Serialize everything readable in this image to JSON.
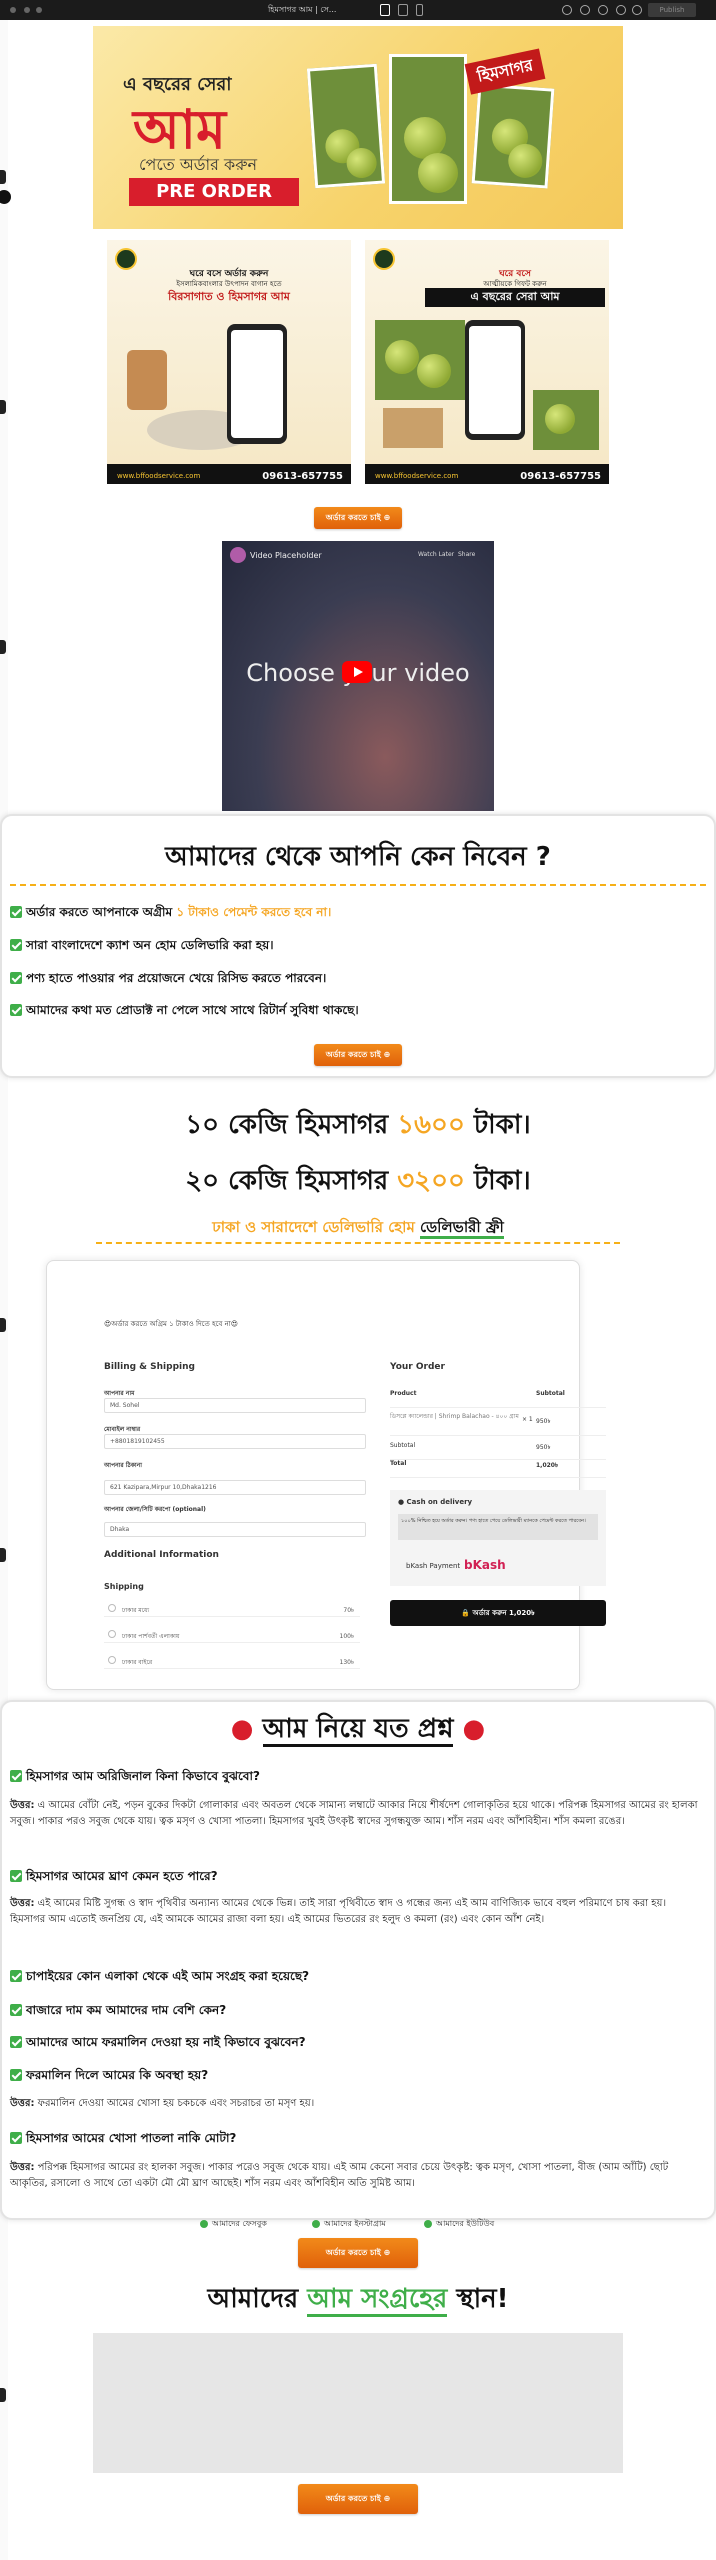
{
  "toolbar": {
    "title": "হিমসাগর আম | সে...",
    "publish": "Publish"
  },
  "hero": {
    "line1": "এ বছরের সেরা",
    "line2": "আম",
    "line3": "পেতে অর্ডার করুন",
    "cta": "PRE ORDER",
    "tag": "হিমসাগর"
  },
  "promo1": {
    "line1": "ঘরে বসে অর্ডার করুন",
    "line2": "ইসলামিকবাংলার উৎপাদন বাগান হতে",
    "line3": "বিরসাগাত ও হিমসাগর আম",
    "url": "www.bffoodservice.com",
    "phone": "09613-657755"
  },
  "promo2": {
    "line1": "ঘরে বসে",
    "line2": "আত্মীয়কে গিফট করুন",
    "line3": "এ বছরের সেরা আম",
    "url": "www.bffoodservice.com",
    "phone": "09613-657755"
  },
  "order_button": "অর্ডার করতে চাই ⊕",
  "video": {
    "title": "Video Placeholder",
    "watch_later": "Watch Later",
    "share": "Share",
    "choose": "Choose your video"
  },
  "why": {
    "title": "আমাদের থেকে আপনি কেন নিবেন ?",
    "items": [
      {
        "text": "অর্ডার করতে আপনাকে অগ্রীম ",
        "highlight": "১ টাকাও পেমেন্ট করতে হবে না।"
      },
      {
        "text": "সারা বাংলাদেশে ক্যাশ অন হোম ডেলিভারি করা হয়।",
        "highlight": ""
      },
      {
        "text": "পণ্য হাতে পাওয়ার পর প্রয়োজনে খেয়ে রিসিভ করতে পারবেন।",
        "highlight": ""
      },
      {
        "text": "আমাদের কথা মত প্রোডাক্ট না পেলে সাথে সাথে রিটার্ন সুবিধা থাকছে।",
        "highlight": ""
      }
    ]
  },
  "pricing": {
    "p1_pre": "১০ কেজি হিমসাগর ",
    "p1_price": "১৬০০",
    "p1_post": " টাকা।",
    "p2_pre": "২০ কেজি হিমসাগর ",
    "p2_price": "৩২০০",
    "p2_post": " টাকা।",
    "delivery_pre": "ঢাকা ও সারাদেশে ডেলিভারি হোম ",
    "delivery_free": "ডেলিভারী ফ্রী"
  },
  "checkout": {
    "notice": "😍অর্ডার করতে অগ্রিম ১ টাকাও দিতে হবে না😍",
    "billing_title": "Billing & Shipping",
    "name_label": "আপনার নাম",
    "name_value": "Md. Sohel",
    "phone_label": "মোবাইল নাম্বার",
    "phone_value": "+8801819102455",
    "address_label": "আপনার ঠিকানা",
    "address_value": "621 Kazipara,Mirpur 10,Dhaka1216",
    "city_label": "আপনার জেলা/সিটি করপো (optional)",
    "city_value": "Dhaka",
    "additional_title": "Additional Information",
    "shipping_title": "Shipping",
    "shipping": [
      {
        "label": "ঢাকার মধ্যে",
        "price": "70৳"
      },
      {
        "label": "ঢাকার পার্শবর্তী এলাকায়",
        "price": "100৳"
      },
      {
        "label": "ঢাকার বাইরে",
        "price": "130৳"
      }
    ],
    "order_title": "Your Order",
    "col_product": "Product",
    "col_subtotal": "Subtotal",
    "product": "ডিসপ্লে ক্যালেন্ডার | Shrimp Balachao - ৪০০ গ্রাম",
    "qty": "× 1",
    "product_price": "950৳",
    "subtotal_label": "Subtotal",
    "subtotal": "950৳",
    "total_label": "Total",
    "total": "1,020৳",
    "cod": "Cash on delivery",
    "cod_note": "১০০% নিশ্চিত হয়ে অর্ডার করুন। পণ্য হাতে পেয়ে ডেলিভারী ম্যানকে পেমেন্ট করতে পারবেন।",
    "bkash": "bKash Payment",
    "bkash_logo": "bKash",
    "place_order": "🔒 অর্ডার করুন  1,020৳"
  },
  "faq": {
    "title": "আম নিয়ে যত প্রশ্ন",
    "q1": "হিমসাগর আম অরিজিনাল কিনা কিভাবে বুঝবো?",
    "a1_label": "উত্তর:",
    "a1": " এ আমের বোঁটা নেই, পড়ন বুকের দিকটা গোলাকার এবং অবতল থেকে সামান্য লম্বাটে আকার নিয়ে শীর্ষদেশ গোলাকৃতির হয়ে থাকে। পরিপক্ক হিমসাগর আমের রং হালকা সবুজ। পাকার পরও সবুজ থেকে যায়। ত্বক মসৃণ ও খোসা পাতলা। হিমসাগর খুবই উৎকৃষ্ট স্বাদের সুগন্ধযুক্ত আম। শাঁস নরম এবং আঁশবিহীন। শাঁস কমলা রঙের।",
    "q2": "হিমসাগর আমের ঘ্রাণ কেমন হতে পারে?",
    "a2_label": "উত্তর:",
    "a2": " এই আমের মিষ্টি সুগন্ধ ও স্বাদ পৃথিবীর অন্যান্য আমের থেকে ভিন্ন। তাই সারা পৃথিবীতে স্বাদ ও গন্ধের জন্য এই আম বাণিজ্যিক ভাবে বহুল পরিমাণে চাষ করা হয়। হিমসাগর আম এতোই জনপ্রিয় যে, এই আমকে আমের রাজা বলা হয়। এই আমের ভিতরের রং হলুদ ও কমলা (রং) এবং কোন আঁশ নেই।",
    "q3": "চাপাইয়ের কোন এলাকা থেকে এই আম সংগ্রহ করা হয়েছে?",
    "q4": "বাজারে দাম কম আমাদের দাম বেশি কেন?",
    "q5": "আমাদের আমে ফরমালিন দেওয়া হয় নাই কিভাবে বুঝবেন?",
    "q6": "ফরমালিন দিলে আমের কি অবস্থা হয়?",
    "a6_label": "উত্তর:",
    "a6": " ফরমালিন দেওয়া আমের খোসা হয় চকচকে এবং সচরাচর তা মসৃণ হয়।",
    "q7": "হিমসাগর আমের খোসা পাতলা নাকি মোটা?",
    "a7_label": "উত্তর:",
    "a7": " পরিপক্ক হিমসাগর আমের রং হালকা সবুজ। পাকার পরেও সবুজ থেকে যায়। এই আম কেনো সবার চেয়ে উৎকৃষ্ট: ত্বক মসৃণ, খোসা পাতলা, বীজ (আম আঁটি) ছোট আকৃতির, রসালো ও সাথে তো একটা মৌ মৌ ঘ্রাণ আছেই। শাঁস নরম এবং আঁশবিহীন অতি সুমিষ্ট আম।"
  },
  "social": {
    "facebook": "আমাদের ফেসবুক",
    "instagram": "আমাদের ইনস্টাগ্রাম",
    "youtube": "আমাদের ইউটিউব"
  },
  "location": {
    "pre": "আমাদের ",
    "highlight": "আম সংগ্রহের",
    "post": " স্থান!"
  },
  "colors": {
    "accent": "#f5a623",
    "button": "#e8711a",
    "check": "#3fae49",
    "brand_red": "#d81e2c"
  }
}
